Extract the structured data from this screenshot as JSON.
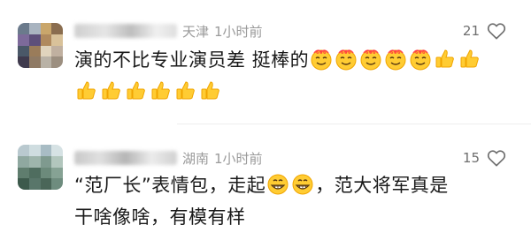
{
  "comments": [
    {
      "location": "天津",
      "time": "1小时前",
      "like_count": "21",
      "text_before": "演的不比专业演员差 挺棒的",
      "emoji_line1": [
        "awesome-face-emoji",
        "awesome-face-emoji",
        "awesome-face-emoji",
        "awesome-face-emoji",
        "awesome-face-emoji",
        "thumbs-up-emoji",
        "thumbs-up-emoji"
      ],
      "emoji_line2": [
        "thumbs-up-emoji",
        "thumbs-up-emoji",
        "thumbs-up-emoji",
        "thumbs-up-emoji",
        "thumbs-up-emoji",
        "thumbs-up-emoji"
      ]
    },
    {
      "location": "湖南",
      "time": "1小时前",
      "like_count": "15",
      "text_part1": "“范厂长”表情包，走起",
      "text_part2": "，范大将军真是",
      "text_line2": "干啥像啥，有模有样",
      "emojis": [
        "grin-emoji",
        "grin-emoji"
      ]
    }
  ],
  "icons": {
    "like": "heart-outline-icon"
  },
  "colors": {
    "meta_text": "#9a9a9a",
    "body_text": "#1a1a1a",
    "emoji_yellow": "#ffcc33",
    "emoji_ring": "#f0a500"
  }
}
